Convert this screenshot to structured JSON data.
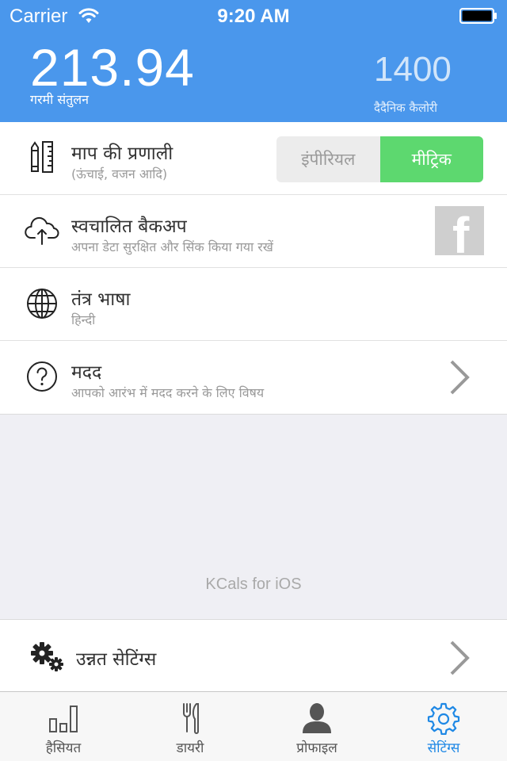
{
  "statusbar": {
    "carrier": "Carrier",
    "time": "9:20 AM"
  },
  "header": {
    "balance_value": "213.94",
    "balance_label": "गरमी संतुलन",
    "daily_value": "1400",
    "daily_label": "दैदैनिक कैलोरी"
  },
  "rows": [
    {
      "icon": "ruler-pencil-icon",
      "title": "माप की प्रणाली",
      "subtitle": "(ऊंचाई, वजन आदि)"
    },
    {
      "icon": "cloud-upload-icon",
      "title": "स्वचालित बैकअप",
      "subtitle": "अपना डेटा सुरक्षित और सिंक किया गया रखें"
    },
    {
      "icon": "globe-icon",
      "title": "तंत्र भाषा",
      "subtitle": "हिन्दी"
    },
    {
      "icon": "help-icon",
      "title": "मदद",
      "subtitle": "आपको आरंभ में मदद करने के लिए विषय"
    }
  ],
  "units": {
    "imperial": "इंपीरियल",
    "metric": "मीट्रिक",
    "selected": "metric"
  },
  "facebook_glyph": "f",
  "brand": "KCals for iOS",
  "advanced": {
    "label": "उन्नत सेटिंग्स",
    "icon": "gears-icon"
  },
  "tabs": [
    {
      "label": "हैसियत",
      "icon": "bar-chart-icon"
    },
    {
      "label": "डायरी",
      "icon": "fork-knife-icon"
    },
    {
      "label": "प्रोफाइल",
      "icon": "person-icon"
    },
    {
      "label": "सेटिंग्स",
      "icon": "gear-icon",
      "active": true
    }
  ],
  "colors": {
    "header": "#4a97ec",
    "accent": "#1e88e5",
    "metric_active": "#5dd86f",
    "facebook_box": "#cfcfcf"
  }
}
